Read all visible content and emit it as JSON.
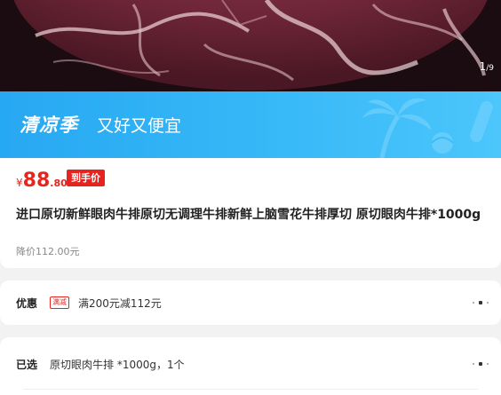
{
  "gallery": {
    "current": "1",
    "total": "/9"
  },
  "banner": {
    "brand": "清凉季",
    "slogan": "又好又便宜"
  },
  "price": {
    "symbol": "¥",
    "integer": "88",
    "decimal": ".80",
    "tag": "到手价"
  },
  "product": {
    "title": "进口原切新鲜眼肉牛排原切无调理牛排新鲜上脑雪花牛排厚切 原切眼肉牛排*1000g",
    "original_price": "降价112.00元"
  },
  "promotion": {
    "label": "优惠",
    "badge": "满减",
    "text": "满200元减112元"
  },
  "selection": {
    "label": "已选",
    "text": "原切眼肉牛排 *1000g，1个"
  },
  "colors": {
    "price_red": "#e5261e",
    "banner_blue": "#2aaaf3",
    "page_bg": "#f2f2f2"
  },
  "icons": [
    "more-dots-icon",
    "palm-tree-icon",
    "beach-ball-icon",
    "surfboard-icon"
  ]
}
